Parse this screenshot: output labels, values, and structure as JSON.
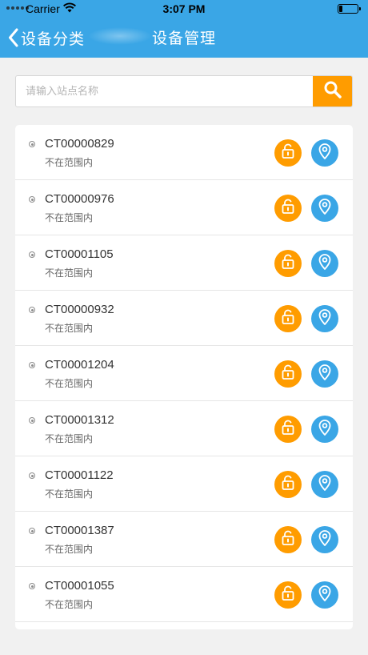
{
  "status_bar": {
    "carrier": "Carrier",
    "time": "3:07 PM"
  },
  "nav": {
    "back_label": "设备分类",
    "title": "设备管理"
  },
  "search": {
    "placeholder": "请输入站点名称",
    "value": ""
  },
  "colors": {
    "primary_blue": "#3aa6e6",
    "accent_orange": "#ff9c00",
    "background": "#f1f1f1"
  },
  "devices": [
    {
      "code": "CT00000829",
      "status": "不在范围内"
    },
    {
      "code": "CT00000976",
      "status": "不在范围内"
    },
    {
      "code": "CT00001105",
      "status": "不在范围内"
    },
    {
      "code": "CT00000932",
      "status": "不在范围内"
    },
    {
      "code": "CT00001204",
      "status": "不在范围内"
    },
    {
      "code": "CT00001312",
      "status": "不在范围内"
    },
    {
      "code": "CT00001122",
      "status": "不在范围内"
    },
    {
      "code": "CT00001387",
      "status": "不在范围内"
    },
    {
      "code": "CT00001055",
      "status": "不在范围内"
    }
  ],
  "icons": {
    "lock": "unlock-icon",
    "location": "location-pin-icon",
    "search": "search-icon",
    "back": "chevron-left-icon"
  }
}
